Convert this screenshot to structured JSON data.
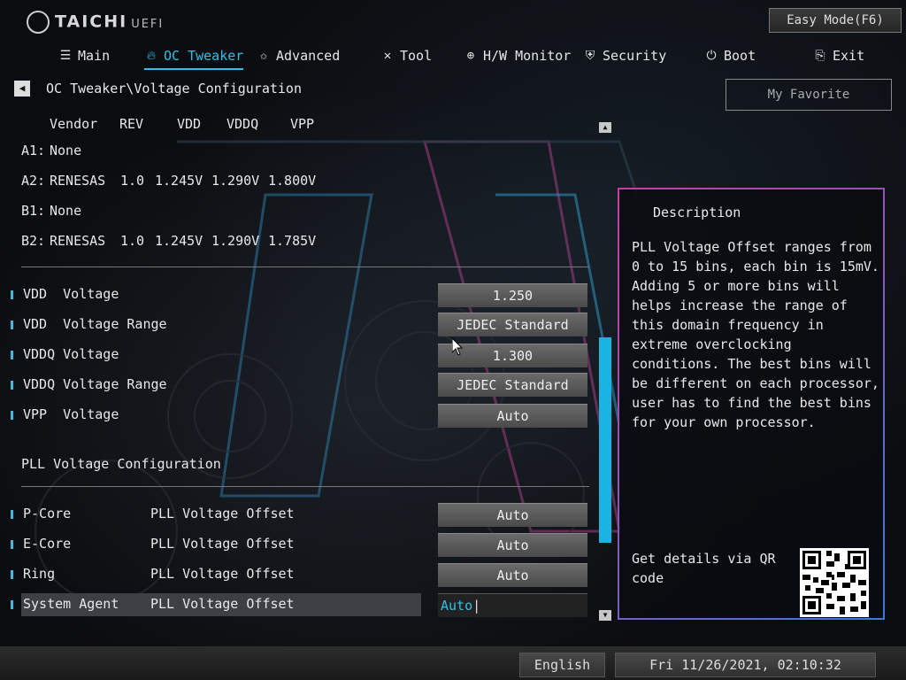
{
  "header": {
    "logo": "TAICHI",
    "logo_suffix": "UEFI",
    "easy_mode": "Easy Mode(F6)"
  },
  "tabs": [
    {
      "label": "Main",
      "icon": "list-icon"
    },
    {
      "label": "OC Tweaker",
      "icon": "flame-icon"
    },
    {
      "label": "Advanced",
      "icon": "star-icon"
    },
    {
      "label": "Tool",
      "icon": "wrench-icon"
    },
    {
      "label": "H/W Monitor",
      "icon": "monitor-icon"
    },
    {
      "label": "Security",
      "icon": "shield-icon"
    },
    {
      "label": "Boot",
      "icon": "power-icon"
    },
    {
      "label": "Exit",
      "icon": "exit-icon"
    }
  ],
  "active_tab": "OC Tweaker",
  "breadcrumb": "OC Tweaker\\Voltage Configuration",
  "my_favorite": "My Favorite",
  "dimm_table": {
    "headers": [
      "Vendor",
      "REV",
      "VDD",
      "VDDQ",
      "VPP"
    ],
    "rows": [
      {
        "slot": "A1:",
        "vendor": "None",
        "rev": "",
        "vdd": "",
        "vddq": "",
        "vpp": ""
      },
      {
        "slot": "A2:",
        "vendor": "RENESAS",
        "rev": "1.0",
        "vdd": "1.245V",
        "vddq": "1.290V",
        "vpp": "1.800V"
      },
      {
        "slot": "B1:",
        "vendor": "None",
        "rev": "",
        "vdd": "",
        "vddq": "",
        "vpp": ""
      },
      {
        "slot": "B2:",
        "vendor": "RENESAS",
        "rev": "1.0",
        "vdd": "1.245V",
        "vddq": "1.290V",
        "vpp": "1.785V"
      }
    ]
  },
  "voltage_settings": [
    {
      "label": "VDD  Voltage",
      "value": "1.250"
    },
    {
      "label": "VDD  Voltage Range",
      "value": "JEDEC Standard"
    },
    {
      "label": "VDDQ Voltage",
      "value": "1.300"
    },
    {
      "label": "VDDQ Voltage Range",
      "value": "JEDEC Standard"
    },
    {
      "label": "VPP  Voltage",
      "value": "Auto"
    }
  ],
  "pll_section_title": "PLL Voltage Configuration",
  "pll_settings": [
    {
      "domain": "P-Core",
      "label": "PLL Voltage Offset",
      "value": "Auto"
    },
    {
      "domain": "E-Core",
      "label": "PLL Voltage Offset",
      "value": "Auto"
    },
    {
      "domain": "Ring",
      "label": "PLL Voltage Offset",
      "value": "Auto"
    },
    {
      "domain": "System Agent",
      "label": "PLL Voltage Offset",
      "value": "Auto"
    }
  ],
  "description": {
    "title": "Description",
    "text": "PLL Voltage Offset ranges from 0 to 15 bins, each bin is 15mV. Adding 5 or more bins will helps increase the range of this domain frequency in extreme overclocking conditions. The best bins will be different on each processor, user has to find the best bins for your own processor.",
    "qr_label": "Get details via QR code"
  },
  "footer": {
    "language": "English",
    "datetime": "Fri 11/26/2021, 02:10:32"
  },
  "colors": {
    "accent": "#2fc0ea",
    "scrollbar": "#1ab4e2",
    "desc_border_start": "#d03aa0",
    "desc_border_end": "#3a7ad8"
  }
}
